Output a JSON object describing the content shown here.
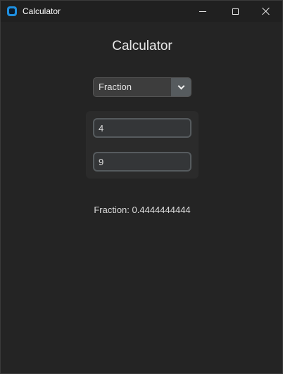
{
  "window": {
    "title": "Calculator",
    "icon": "app-icon",
    "controls": [
      "minimize-icon",
      "maximize-icon",
      "close-icon"
    ]
  },
  "main": {
    "heading": "Calculator",
    "mode_dropdown": {
      "selected": "Fraction"
    },
    "inputs": {
      "numerator": "4",
      "denominator": "9"
    },
    "result_text": "Fraction: 0.4444444444"
  },
  "colors": {
    "background": "#242424",
    "titlebar": "#202020",
    "field_background": "#343638",
    "field_border": "#565b5e",
    "app_icon": "#1e8fe0",
    "text": "#dcdcdc"
  }
}
